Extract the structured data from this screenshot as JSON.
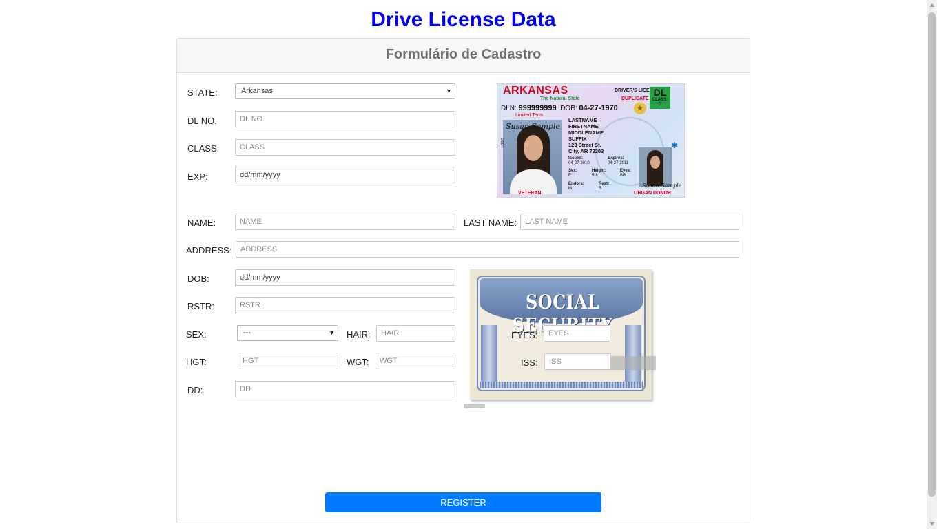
{
  "page": {
    "title": "Drive License Data"
  },
  "form": {
    "header": "Formulário de Cadastro",
    "state": {
      "label": "STATE:",
      "value": "Arkansas"
    },
    "dl_no": {
      "label": "DL NO.",
      "placeholder": "DL NO."
    },
    "class": {
      "label": "CLASS:",
      "placeholder": "CLASS"
    },
    "exp": {
      "label": "EXP:",
      "placeholder": "dd/mm/yyyy"
    },
    "name": {
      "label": "NAME:",
      "placeholder": "NAME"
    },
    "last_name": {
      "label": "LAST NAME:",
      "placeholder": "LAST NAME"
    },
    "address": {
      "label": "ADDRESS:",
      "placeholder": "ADDRESS"
    },
    "dob": {
      "label": "DOB:",
      "placeholder": "dd/mm/yyyy"
    },
    "rstr": {
      "label": "RSTR:",
      "placeholder": "RSTR"
    },
    "sex": {
      "label": "SEX:",
      "value": "---"
    },
    "hair": {
      "label": "HAIR:",
      "placeholder": "HAIR"
    },
    "hgt": {
      "label": "HGT:",
      "placeholder": "HGT"
    },
    "wgt": {
      "label": "WGT:",
      "placeholder": "WGT"
    },
    "dd": {
      "label": "DD:",
      "placeholder": "DD"
    },
    "eyes": {
      "label": "EYES:",
      "placeholder": "EYES"
    },
    "iss": {
      "label": "ISS:",
      "placeholder": "ISS"
    },
    "register_label": "REGISTER"
  },
  "dl_card": {
    "state": "ARKANSAS",
    "motto": "The Natural State",
    "type": "DRIVER'S LICENSE",
    "duplicate": "DUPLICATE",
    "class_badge": "DL",
    "class_label": "CLASS:",
    "class_value": "D",
    "dln_label": "DLN:",
    "dln": "999999999",
    "dob_label": "DOB:",
    "dob": "04-27-1970",
    "limited": "Limited Term",
    "lastname": "LASTNAME",
    "firstname": "FIRSTNAME",
    "middlename": "MIDDLENAME",
    "suffix": "SUFFIX",
    "street": "123 Street St.",
    "city": "City, AR 72203",
    "issued_label": "Issued:",
    "issued": "04-27-2010",
    "expires_label": "Expires:",
    "expires": "04-27-2011",
    "sex_label": "Sex:",
    "sex": "F",
    "height_label": "Height:",
    "height": "5-8",
    "eyes_label": "Eyes:",
    "eyes": "BR",
    "endors_label": "Endors:",
    "endors": "M",
    "restr_label": "Restr:",
    "restr": "B",
    "veteran": "VETERAN",
    "donor": "ORGAN DONOR",
    "signature": "Susan Sample",
    "side": "LOGO"
  },
  "ss_card": {
    "title": "SOCIAL SECURITY"
  },
  "colors": {
    "title": "#0000ee",
    "button": "#007bff",
    "header_bg": "#f7f7f7"
  }
}
